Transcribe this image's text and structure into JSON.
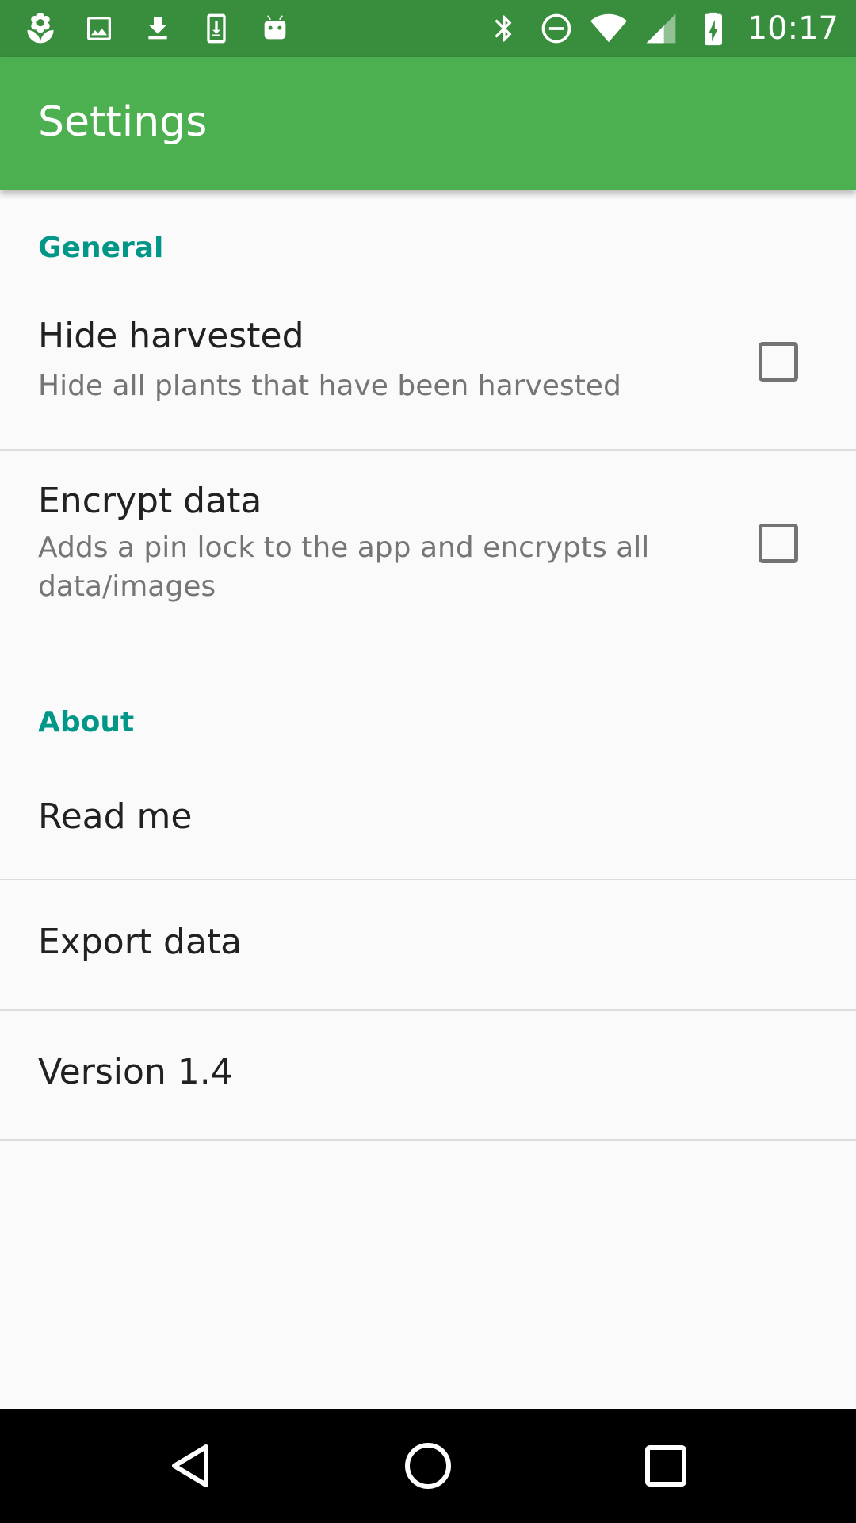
{
  "status_bar": {
    "time": "10:17",
    "left_icons": [
      "plant-icon",
      "image-icon",
      "download-icon",
      "sd-download-icon",
      "android-icon"
    ],
    "right_icons": [
      "bluetooth-icon",
      "do-not-disturb-icon",
      "wifi-icon",
      "cell-signal-icon",
      "battery-charging-icon"
    ],
    "color": "#388e3c"
  },
  "app_bar": {
    "title": "Settings",
    "color": "#4caf50"
  },
  "sections": {
    "general": {
      "title": "General",
      "items": [
        {
          "title": "Hide harvested",
          "summary": "Hide all plants that have been harvested",
          "checked": false
        },
        {
          "title": "Encrypt data",
          "summary": "Adds a pin lock to the app and encrypts all data/images",
          "checked": false
        }
      ]
    },
    "about": {
      "title": "About",
      "items": [
        {
          "title": "Read me"
        },
        {
          "title": "Export data"
        },
        {
          "title": "Version 1.4"
        }
      ]
    }
  },
  "accent_color": "#009688",
  "nav_bar": {
    "buttons": [
      "back-icon",
      "home-icon",
      "recents-icon"
    ]
  }
}
